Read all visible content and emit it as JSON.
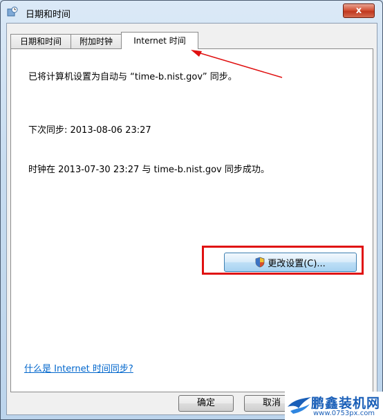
{
  "window": {
    "title": "日期和时间",
    "close_label": "x"
  },
  "tabs": [
    {
      "label": "日期和时间"
    },
    {
      "label": "附加时钟"
    },
    {
      "label": "Internet 时间",
      "active": true
    }
  ],
  "panel": {
    "sync_status": "已将计算机设置为自动与 “time-b.nist.gov” 同步。",
    "next_sync": "下次同步: 2013-08-06 23:27",
    "last_sync": "时钟在 2013-07-30 23:27 与 time-b.nist.gov 同步成功。",
    "change_settings_label": "更改设置(C)...",
    "help_link": "什么是 Internet 时间同步?"
  },
  "buttons": {
    "ok": "确定",
    "cancel": "取消"
  },
  "watermark": {
    "brand": "鹏鑫装机网",
    "url": "www.0753px.com"
  },
  "colors": {
    "annotation": "#e01010",
    "link": "#0066cc"
  },
  "icons": {
    "title": "clock-icon",
    "shield": "uac-shield-icon"
  }
}
